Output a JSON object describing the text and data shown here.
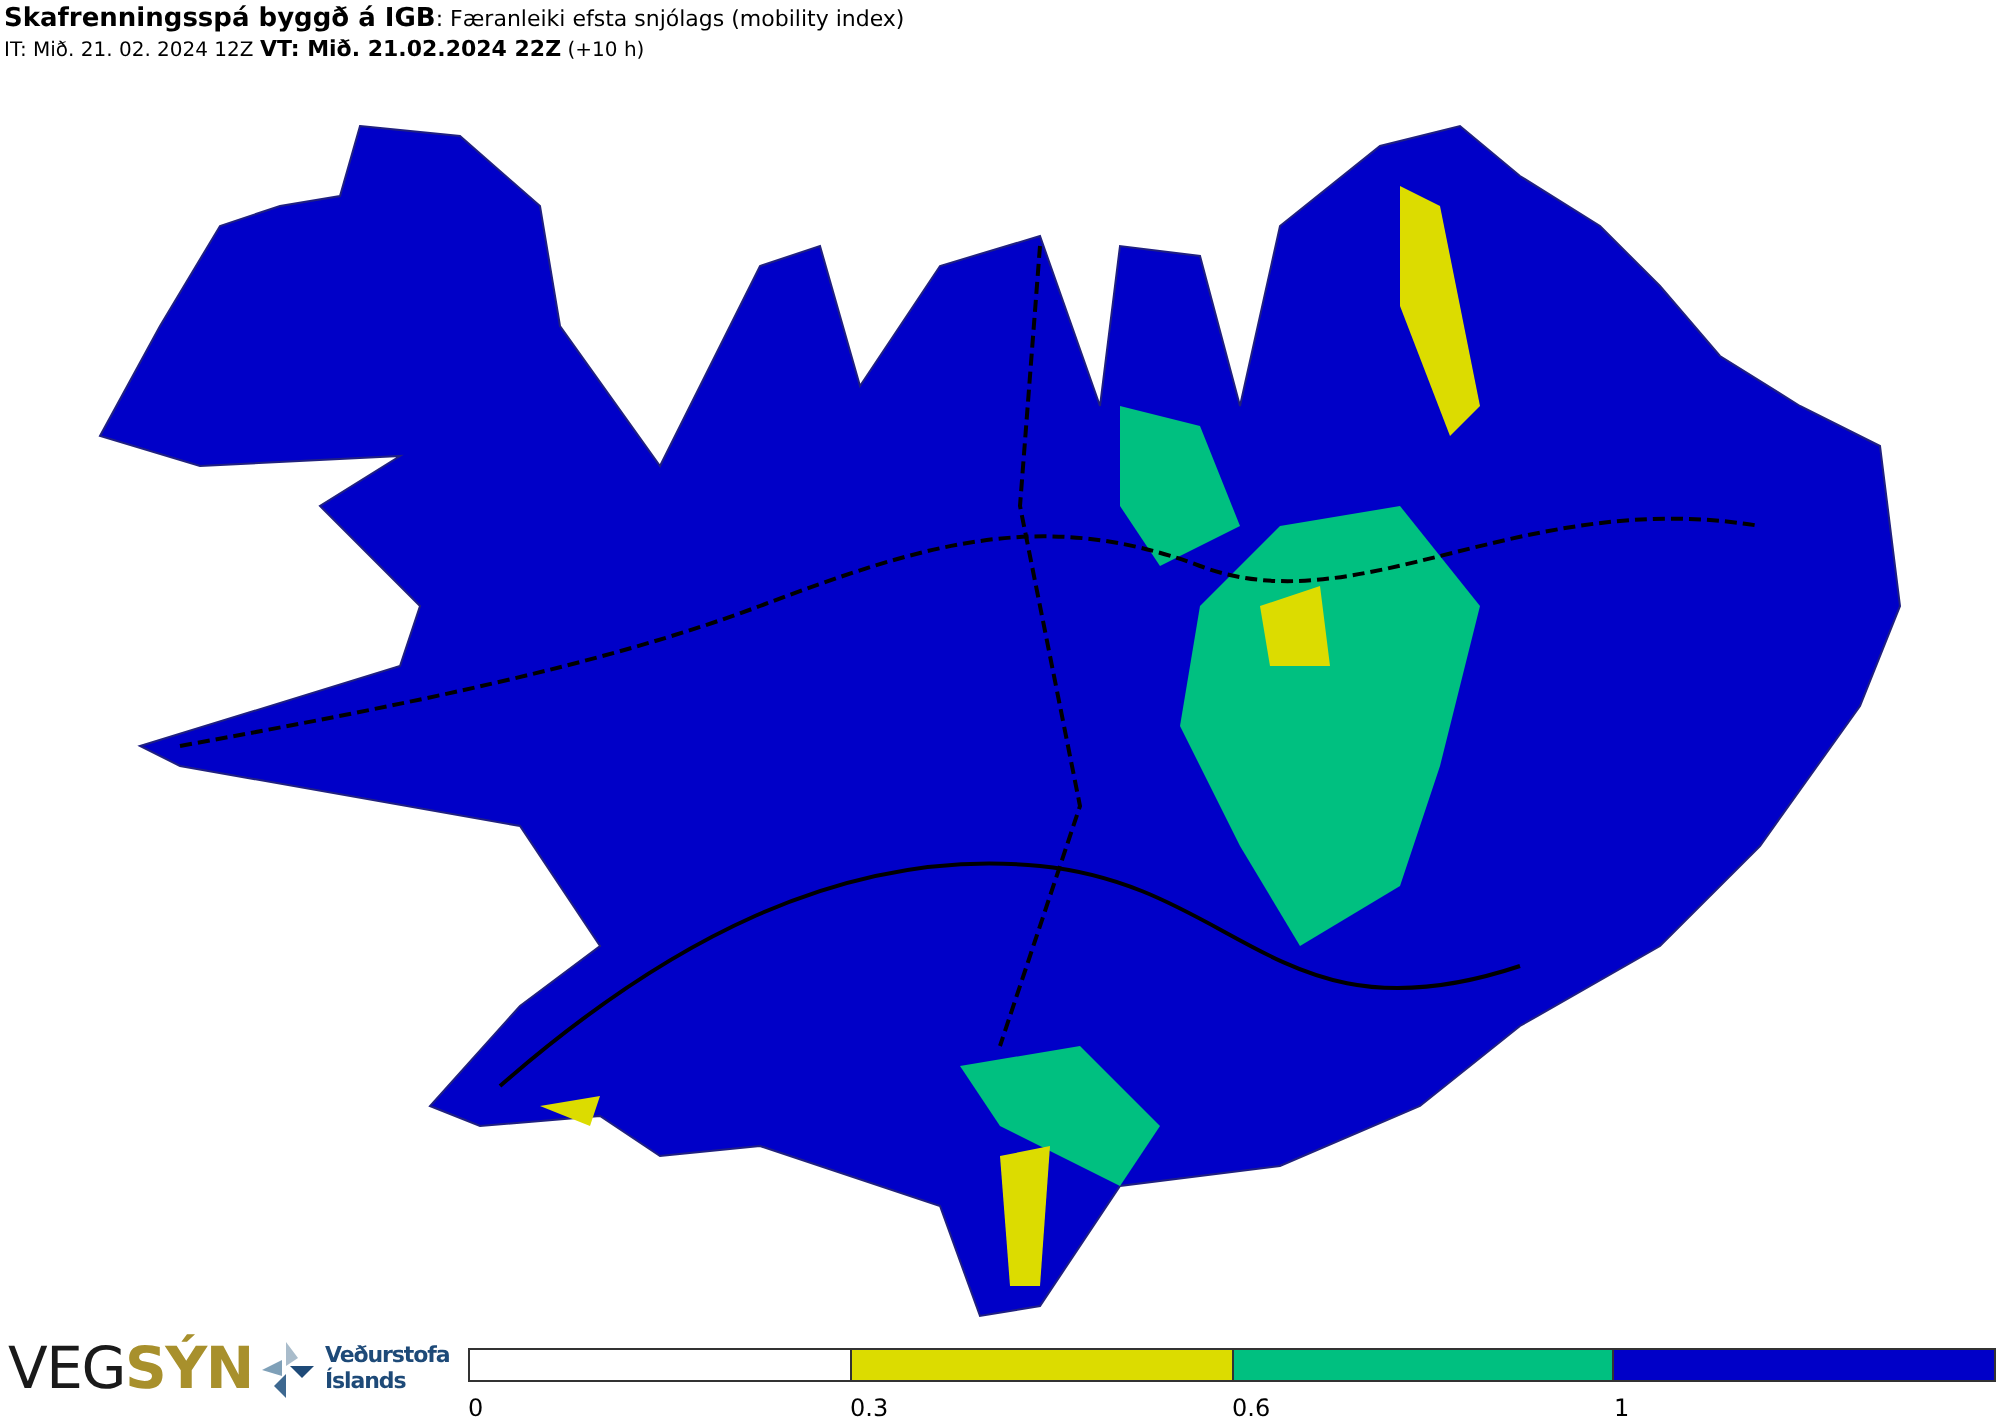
{
  "header": {
    "title": "**Skafrenningsspá byggð á IGB**: Færanleiki efsta snjólags (mobility index)",
    "timestamp": "IT: Mið. 21. 02. 2024 12Z **VT: Mið. 21.02.2024 22Z** (+10 h)"
  },
  "logos": {
    "vegsyn": "VEG**SÝN**",
    "vedurstofa": [
      "Veðurstofa",
      "Íslands"
    ]
  },
  "legend": {
    "bins": [
      {
        "color": "#ffffff",
        "tick": "0"
      },
      {
        "color": "#dcdc00",
        "tick": "0.3"
      },
      {
        "color": "#00c080",
        "tick": "0.6"
      },
      {
        "color": "#0000c8",
        "tick": "1"
      }
    ]
  }
}
